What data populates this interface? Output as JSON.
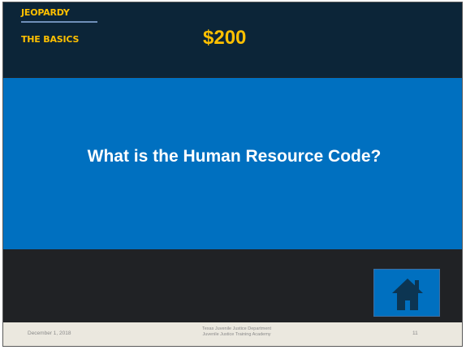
{
  "header": {
    "title": "Jeopardy",
    "category": "The Basics",
    "amount": "$200"
  },
  "answer": {
    "text": "What is the Human Resource Code?"
  },
  "nav": {
    "home_icon": "home-icon"
  },
  "footer": {
    "date": "December 1, 2018",
    "org_line1": "Texas Juvenile Justice Department",
    "org_line2": "Juvenile Justice Training Academy",
    "page_number": "11"
  },
  "colors": {
    "top_band": "#0c2538",
    "accent_gold": "#ffc000",
    "answer_blue": "#0070c0",
    "slide_dark": "#202225",
    "footer_bg": "#ebe8df",
    "house_icon": "#0c3552"
  }
}
